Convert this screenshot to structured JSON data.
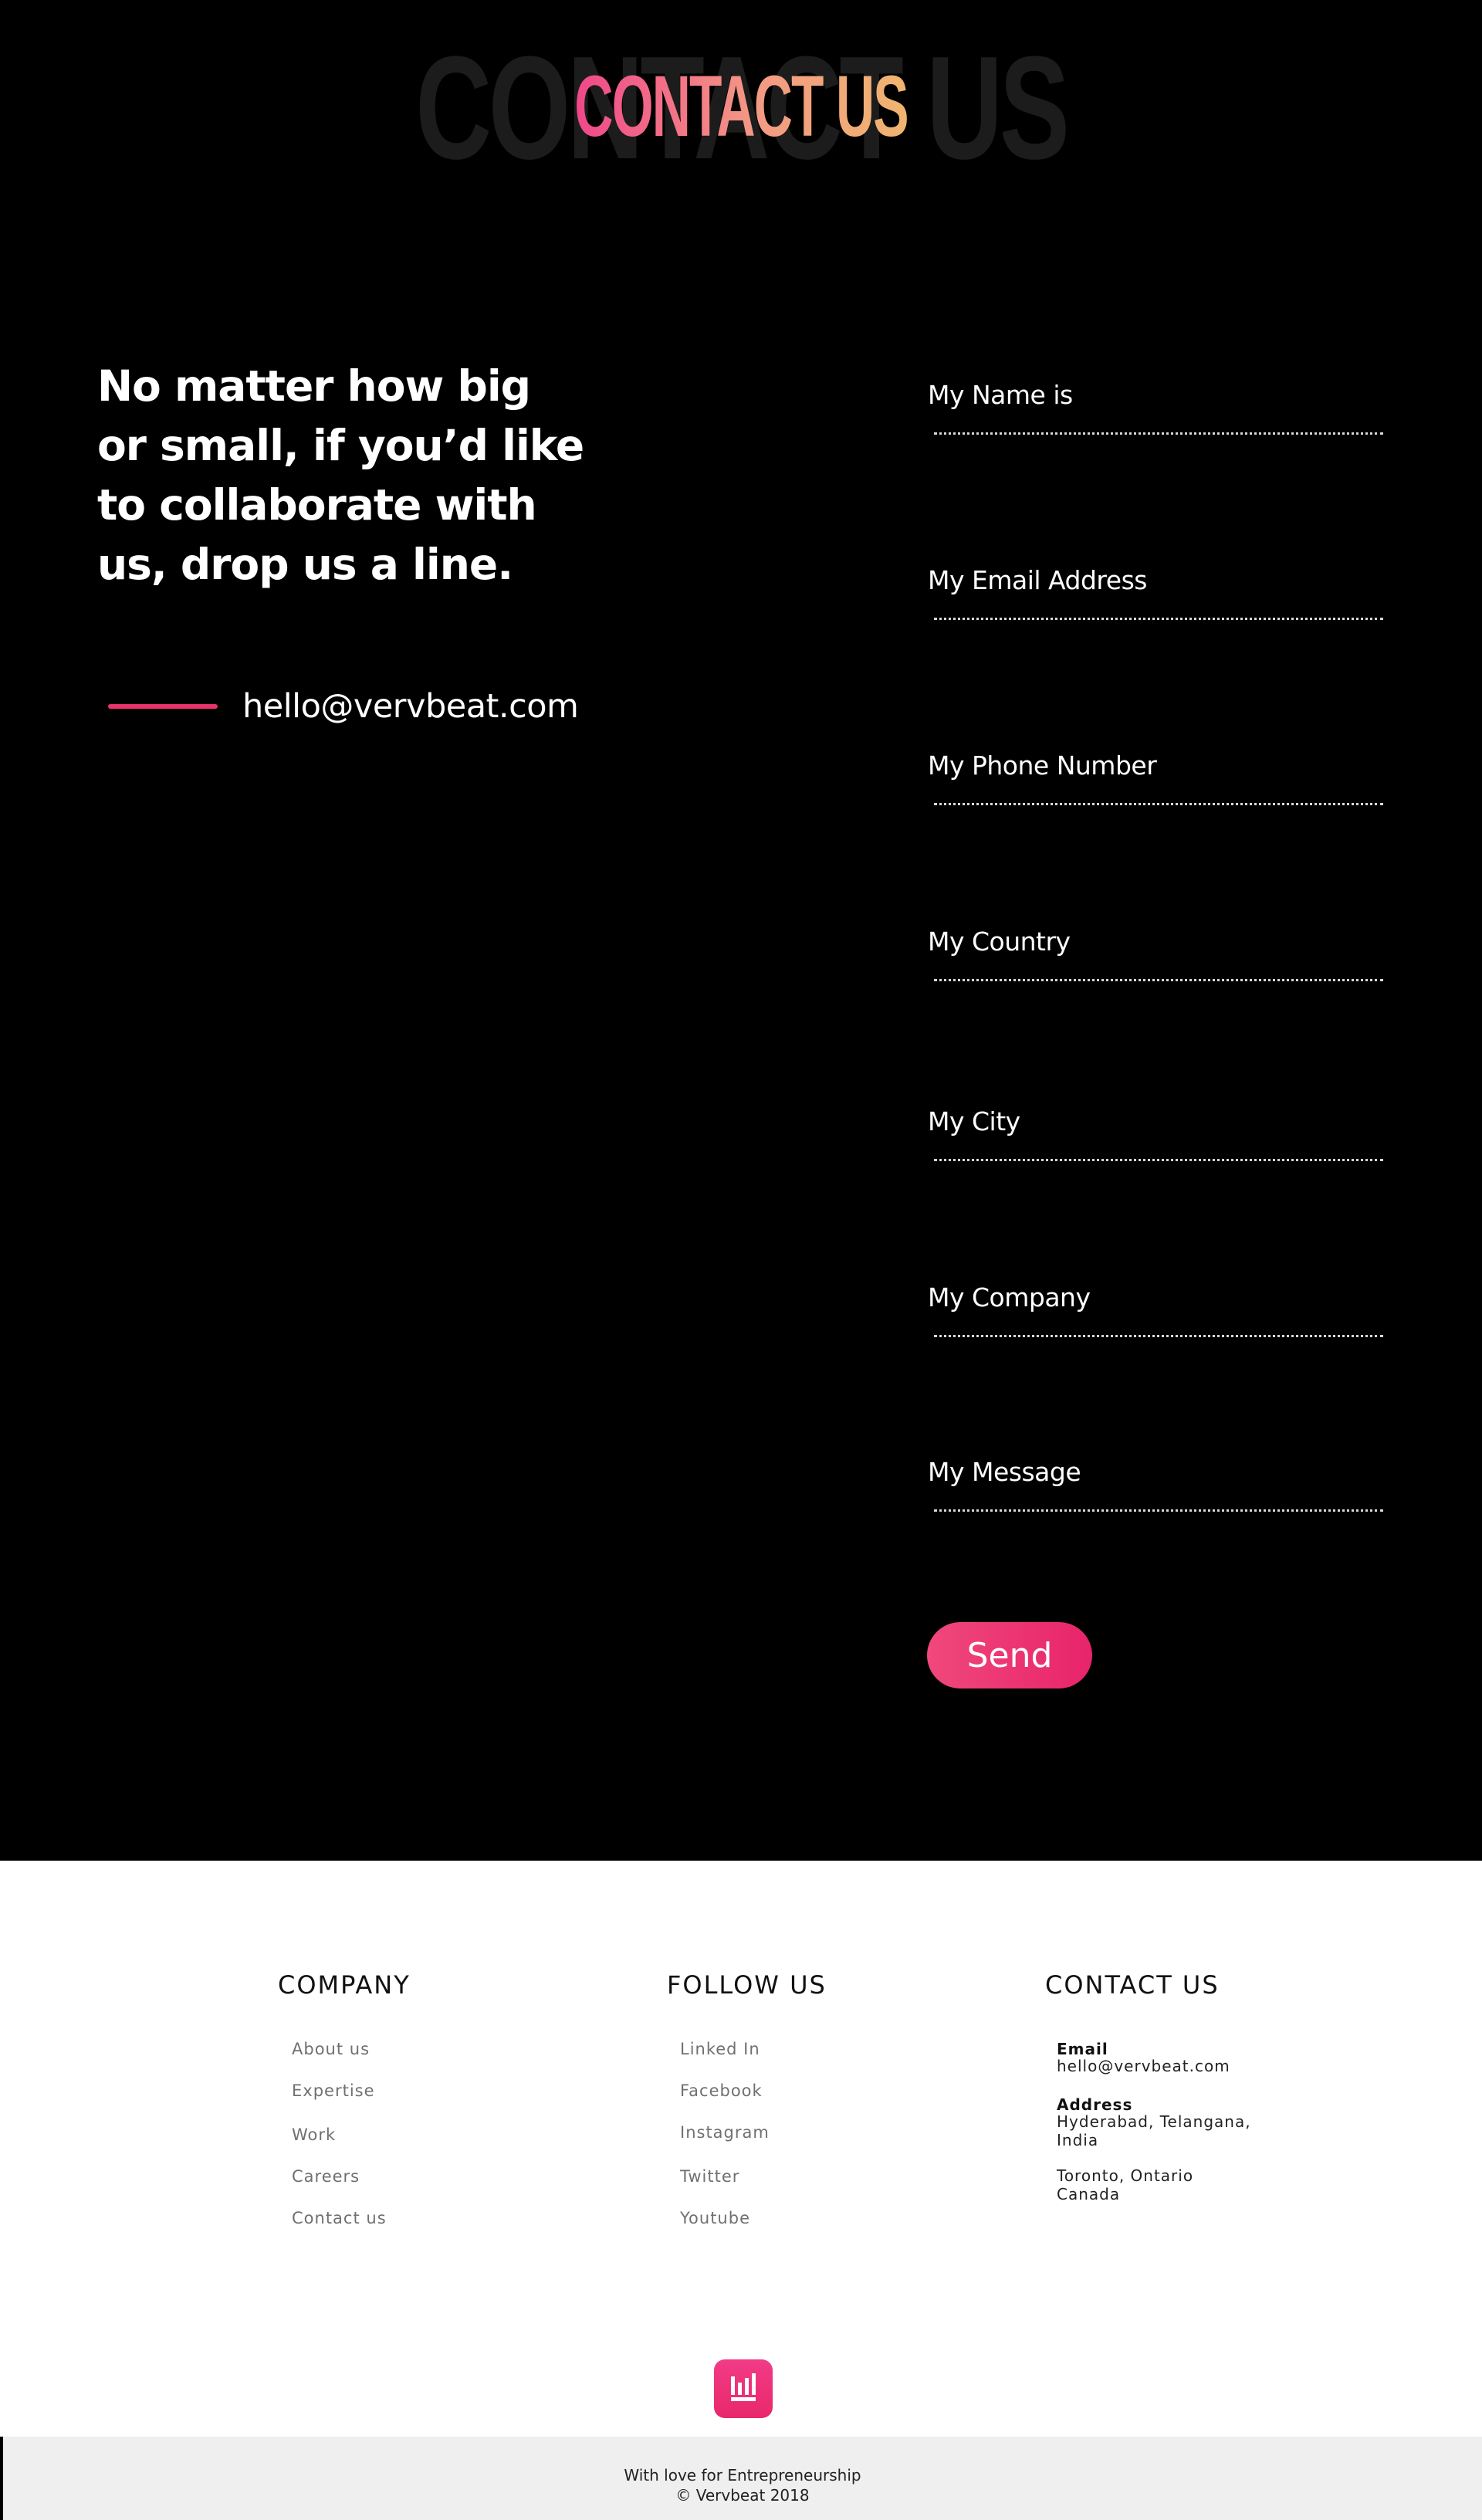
{
  "hero": {
    "bg_title": "CONTACT US",
    "title": "CONTACT US",
    "tagline": "No matter how big or small, if you’d like to collaborate with us, drop us a line.",
    "email": "hello@vervbeat.com"
  },
  "form": {
    "fields": [
      {
        "label": "My Name is"
      },
      {
        "label": "My Email Address"
      },
      {
        "label": "My Phone Number"
      },
      {
        "label": "My Country"
      },
      {
        "label": "My City"
      },
      {
        "label": "My Company"
      },
      {
        "label": "My Message"
      }
    ],
    "send_label": "Send"
  },
  "footer": {
    "company": {
      "title": "COMPANY",
      "links": [
        "About us",
        "Expertise",
        "Work",
        "Careers",
        "Contact us"
      ]
    },
    "follow": {
      "title": "FOLLOW US",
      "links": [
        "Linked In",
        "Facebook",
        "Instagram",
        "Twitter",
        "Youtube"
      ]
    },
    "contact": {
      "title": "CONTACT US",
      "email_label": "Email",
      "email_value": "hello@vervbeat.com",
      "address_label": "Address",
      "address_line1": "Hyderabad, Telangana,",
      "address_line2": "India",
      "address2_line1": "Toronto, Ontario",
      "address2_line2": "Canada"
    },
    "logo_icon": "vervbeat-logo-icon",
    "bottom_line1": "With love for Entrepreneurship",
    "bottom_line2": "© Vervbeat  2018"
  },
  "colors": {
    "accent": "#e8336b",
    "button": "#f0487c",
    "title_gradient_start": "#f0478a",
    "title_gradient_end": "#f0b56f"
  }
}
